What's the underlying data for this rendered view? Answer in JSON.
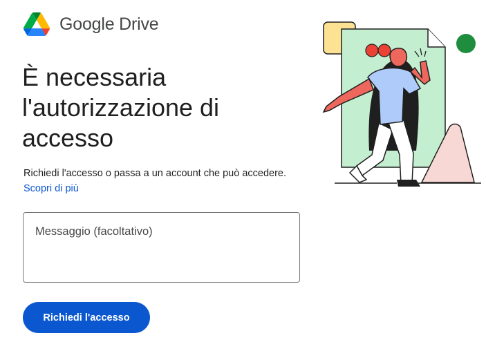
{
  "brand": {
    "logo_icon": "google-drive-logo",
    "name": "Google Drive"
  },
  "main": {
    "title": "È necessaria l'autorizzazione di accesso",
    "subtitle": "Richiedi l'accesso o passa a un account che può accedere.",
    "learn_more_link": "Scopri di più",
    "message_placeholder": "Messaggio (facoltativo)",
    "message_value": "",
    "request_button_label": "Richiedi l'accesso"
  },
  "illustration": {
    "icon": "person-stepping-out-of-document-illustration"
  },
  "colors": {
    "accent": "#0b57d0",
    "link": "#0b57d0",
    "illustration_green_doc": "#c4eed0",
    "illustration_green_dot": "#1e8e3e",
    "illustration_yellow": "#fde293",
    "illustration_pink": "#f8d8d4",
    "illustration_red_hair": "#ea4335",
    "illustration_shirt": "#aecbfa"
  }
}
